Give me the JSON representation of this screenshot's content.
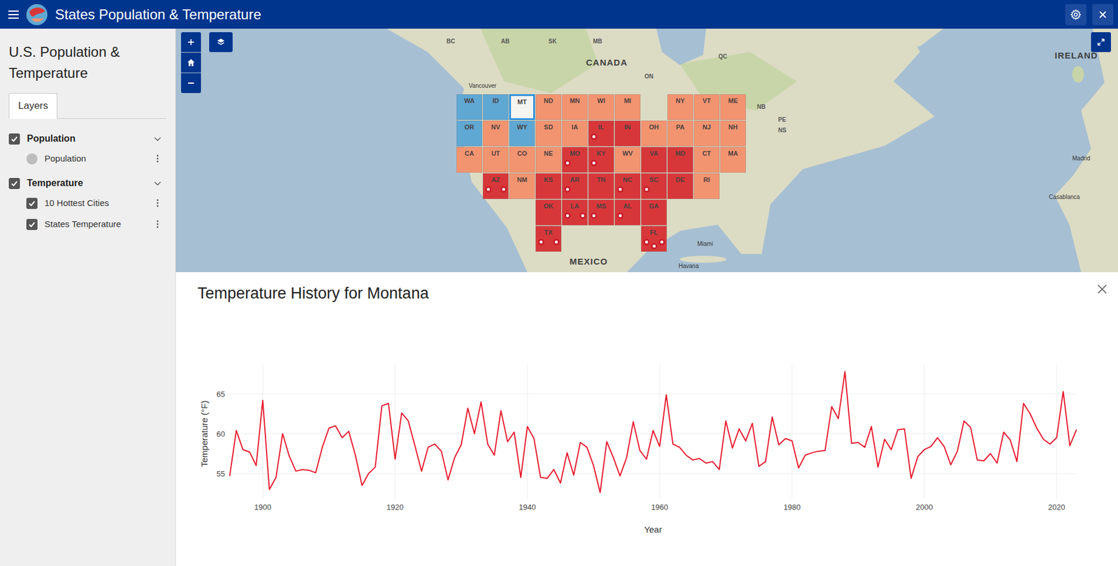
{
  "header": {
    "title": "States Population & Temperature"
  },
  "sidebar": {
    "title": "U.S. Population & Temperature",
    "tabs": [
      {
        "label": "Layers",
        "selected": true
      }
    ],
    "groups": [
      {
        "label": "Population",
        "checked": true,
        "expanded": true,
        "layers": [
          {
            "label": "Population",
            "kind": "symbol"
          }
        ]
      },
      {
        "label": "Temperature",
        "checked": true,
        "expanded": true,
        "layers": [
          {
            "label": "10 Hottest Cities",
            "kind": "checkbox",
            "checked": true
          },
          {
            "label": "States Temperature",
            "kind": "checkbox",
            "checked": true
          }
        ]
      }
    ]
  },
  "map": {
    "states": [
      {
        "label": "WA",
        "color": "#5fa8d3",
        "selected": false
      },
      {
        "label": "ID",
        "color": "#5fa8d3",
        "selected": false
      },
      {
        "label": "MT",
        "color": "#5fa8d3",
        "selected": true
      },
      {
        "label": "ND",
        "color": "#f29470",
        "selected": false
      },
      {
        "label": "MN",
        "color": "#f29470",
        "selected": false
      },
      {
        "label": "WI",
        "color": "#f29470",
        "selected": false
      },
      {
        "label": "MI",
        "color": "#f29470",
        "selected": false
      },
      {
        "label": "NY",
        "color": "#f29470",
        "selected": false
      },
      {
        "label": "VT",
        "color": "#f29470",
        "selected": false
      },
      {
        "label": "ME",
        "color": "#f29470",
        "selected": false
      },
      {
        "label": "OR",
        "color": "#5fa8d3",
        "selected": false
      },
      {
        "label": "NV",
        "color": "#f29470",
        "selected": false
      },
      {
        "label": "WY",
        "color": "#5fa8d3",
        "selected": false
      },
      {
        "label": "SD",
        "color": "#f29470",
        "selected": false
      },
      {
        "label": "IA",
        "color": "#f29470",
        "selected": false
      },
      {
        "label": "IL",
        "color": "#d8373a",
        "selected": false
      },
      {
        "label": "IN",
        "color": "#d8373a",
        "selected": false
      },
      {
        "label": "OH",
        "color": "#f29470",
        "selected": false
      },
      {
        "label": "PA",
        "color": "#f29470",
        "selected": false
      },
      {
        "label": "NJ",
        "color": "#f29470",
        "selected": false
      },
      {
        "label": "NH",
        "color": "#f29470",
        "selected": false
      },
      {
        "label": "CA",
        "color": "#f29470",
        "selected": false
      },
      {
        "label": "UT",
        "color": "#f29470",
        "selected": false
      },
      {
        "label": "CO",
        "color": "#f29470",
        "selected": false
      },
      {
        "label": "NE",
        "color": "#f29470",
        "selected": false
      },
      {
        "label": "MO",
        "color": "#d8373a",
        "selected": false
      },
      {
        "label": "KY",
        "color": "#d8373a",
        "selected": false
      },
      {
        "label": "WV",
        "color": "#f29470",
        "selected": false
      },
      {
        "label": "VA",
        "color": "#d8373a",
        "selected": false
      },
      {
        "label": "MD",
        "color": "#d8373a",
        "selected": false
      },
      {
        "label": "CT",
        "color": "#f29470",
        "selected": false
      },
      {
        "label": "MA",
        "color": "#f29470",
        "selected": false
      },
      {
        "label": "AZ",
        "color": "#d8373a",
        "selected": false
      },
      {
        "label": "NM",
        "color": "#f29470",
        "selected": false
      },
      {
        "label": "KS",
        "color": "#d8373a",
        "selected": false
      },
      {
        "label": "AR",
        "color": "#d8373a",
        "selected": false
      },
      {
        "label": "TN",
        "color": "#d8373a",
        "selected": false
      },
      {
        "label": "NC",
        "color": "#d8373a",
        "selected": false
      },
      {
        "label": "SC",
        "color": "#d8373a",
        "selected": false
      },
      {
        "label": "DE",
        "color": "#d8373a",
        "selected": false
      },
      {
        "label": "RI",
        "color": "#f29470",
        "selected": false
      },
      {
        "label": "OK",
        "color": "#d8373a",
        "selected": false
      },
      {
        "label": "LA",
        "color": "#d8373a",
        "selected": false
      },
      {
        "label": "MS",
        "color": "#d8373a",
        "selected": false
      },
      {
        "label": "AL",
        "color": "#d8373a",
        "selected": false
      },
      {
        "label": "GA",
        "color": "#d8373a",
        "selected": false
      },
      {
        "label": "TX",
        "color": "#d8373a",
        "selected": false
      },
      {
        "label": "FL",
        "color": "#d8373a",
        "selected": false
      }
    ],
    "pins": [
      {
        "state": "AZ"
      },
      {
        "state": "AZ"
      },
      {
        "state": "TX"
      },
      {
        "state": "TX"
      },
      {
        "state": "LA"
      },
      {
        "state": "LA"
      },
      {
        "state": "MS"
      },
      {
        "state": "MO"
      },
      {
        "state": "IL"
      },
      {
        "state": "KY"
      },
      {
        "state": "AR"
      },
      {
        "state": "AL"
      },
      {
        "state": "NC"
      },
      {
        "state": "SC"
      },
      {
        "state": "FL"
      },
      {
        "state": "FL"
      },
      {
        "state": "FL"
      }
    ],
    "labels": [
      {
        "text": "CANADA",
        "kind": "country"
      },
      {
        "text": "MEXICO",
        "kind": "country"
      },
      {
        "text": "IRELAND",
        "kind": "country"
      },
      {
        "text": "BC",
        "kind": "province"
      },
      {
        "text": "AB",
        "kind": "province"
      },
      {
        "text": "SK",
        "kind": "province"
      },
      {
        "text": "MB",
        "kind": "province"
      },
      {
        "text": "ON",
        "kind": "province"
      },
      {
        "text": "QC",
        "kind": "province"
      },
      {
        "text": "NB",
        "kind": "province"
      },
      {
        "text": "PE",
        "kind": "province"
      },
      {
        "text": "NS",
        "kind": "province"
      },
      {
        "text": "Vancouver",
        "kind": "city"
      },
      {
        "text": "Miami",
        "kind": "city"
      },
      {
        "text": "Havana",
        "kind": "city"
      },
      {
        "text": "Madrid",
        "kind": "city"
      },
      {
        "text": "Casablanca",
        "kind": "city"
      }
    ]
  },
  "chart": {
    "title": "Temperature History for Montana",
    "y_axis": {
      "title": "Temperature (°F)",
      "ticks": [
        "55",
        "60",
        "65"
      ]
    },
    "x_axis": {
      "title": "Year",
      "ticks": [
        "1900",
        "1920",
        "1940",
        "1960",
        "1980",
        "2000",
        "2020"
      ]
    },
    "series": [
      {
        "color": "#e8192c",
        "start_year": 1895,
        "values": [
          54.7,
          60.4,
          58,
          57.7,
          56,
          64.2,
          53,
          54.5,
          60,
          57.2,
          55.3,
          55.5,
          55.4,
          55.1,
          58.3,
          60.7,
          61,
          59.5,
          60.3,
          57.3,
          53.5,
          55,
          55.8,
          63.5,
          63.8,
          56.8,
          62.6,
          61.6,
          58.5,
          55.3,
          58.3,
          58.7,
          57.8,
          54.2,
          57,
          58.6,
          63.2,
          60,
          64,
          58.7,
          57.3,
          62.9,
          59,
          60.2,
          54.5,
          60.9,
          59.4,
          54.5,
          54.4,
          55.5,
          53.8,
          57.6,
          54.8,
          58.9,
          58.3,
          56,
          52.6,
          59,
          57,
          54.7,
          57,
          61.5,
          57.9,
          56.8,
          60.4,
          58.4,
          64.9,
          58.7,
          58.3,
          57.3,
          56.7,
          56.9,
          56.3,
          56.5,
          55.5,
          61.6,
          58.2,
          60.6,
          59.1,
          61.3,
          55.9,
          56.5,
          62.1,
          58.6,
          59.4,
          59.1,
          55.7,
          57.3,
          57.6,
          57.8,
          57.9,
          63.4,
          61.9,
          67.8,
          58.8,
          58.9,
          58.3,
          60.9,
          55.8,
          59.3,
          58,
          60.5,
          60.6,
          54.4,
          57.1,
          58,
          58.4,
          59.5,
          58.4,
          56.1,
          57.8,
          61.6,
          60.8,
          56.7,
          56.6,
          57.5,
          56.3,
          60.2,
          59.2,
          56.5,
          63.8,
          62.5,
          60.7,
          59.3,
          58.7,
          59.5,
          65.3,
          58.5,
          60.5
        ]
      }
    ]
  }
}
